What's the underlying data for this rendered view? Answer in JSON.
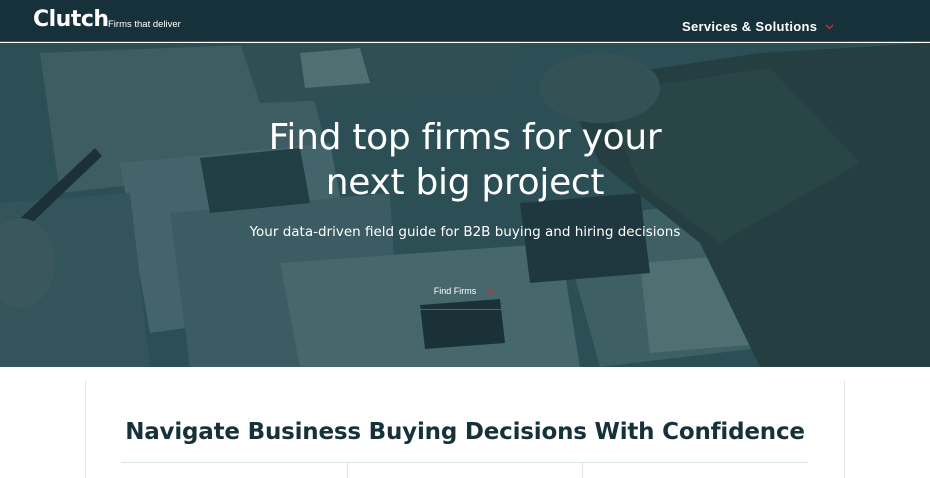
{
  "header": {
    "logo": "Clutch",
    "tagline": "Firms that deliver",
    "nav_services_label": "Services & Solutions"
  },
  "hero": {
    "title_line1": "Find top firms for your",
    "title_line2": "next big project",
    "subtitle": "Your data-driven field guide for B2B buying and hiring decisions",
    "find_button_label": "Find Firms"
  },
  "section": {
    "heading": "Navigate Business Buying Decisions With Confidence"
  },
  "colors": {
    "header_bg": "#17313b",
    "hero_tint": "#32555b",
    "accent_red": "#e1262d",
    "heading_text": "#17313b"
  },
  "icons": {
    "nav_chevron": "chevron-down-icon",
    "button_chevron": "chevron-down-icon"
  }
}
